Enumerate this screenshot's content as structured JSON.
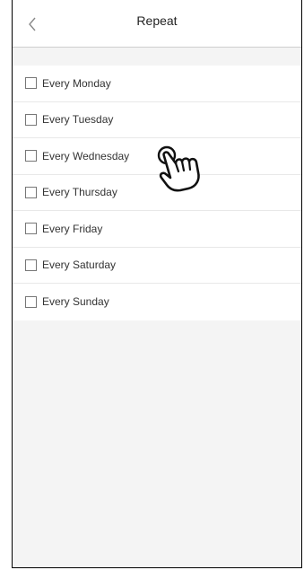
{
  "header": {
    "title": "Repeat",
    "back_icon": "chevron-left-icon"
  },
  "days": [
    {
      "label": "Every Monday",
      "checked": false
    },
    {
      "label": "Every Tuesday",
      "checked": false
    },
    {
      "label": "Every Wednesday",
      "checked": false
    },
    {
      "label": "Every Thursday",
      "checked": false
    },
    {
      "label": "Every Friday",
      "checked": false
    },
    {
      "label": "Every Saturday",
      "checked": false
    },
    {
      "label": "Every Sunday",
      "checked": false
    }
  ],
  "gesture": {
    "icon": "tap-hand-icon",
    "target": "Every Wednesday"
  }
}
